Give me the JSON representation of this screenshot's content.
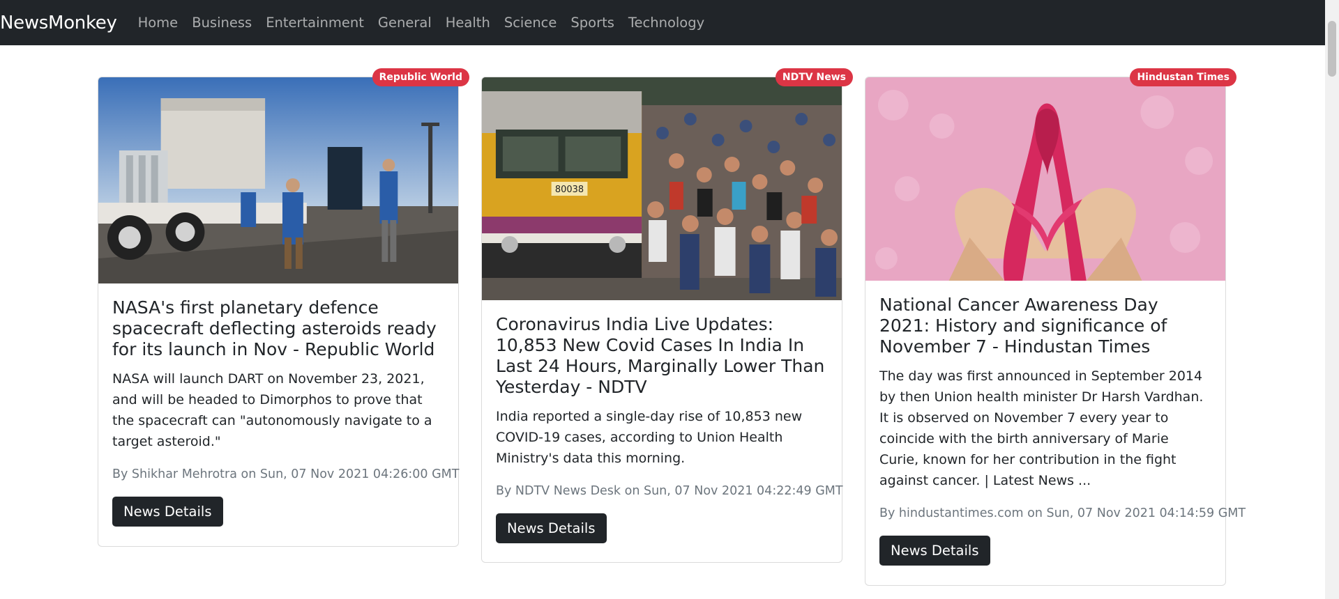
{
  "app": {
    "brand": "NewsMonkey"
  },
  "nav": {
    "items": [
      {
        "label": "Home"
      },
      {
        "label": "Business"
      },
      {
        "label": "Entertainment"
      },
      {
        "label": "General"
      },
      {
        "label": "Health"
      },
      {
        "label": "Science"
      },
      {
        "label": "Sports"
      },
      {
        "label": "Technology"
      }
    ]
  },
  "articles": [
    {
      "source": "Republic World",
      "title": "NASA's first planetary defence spacecraft deflecting asteroids ready for its launch in Nov - Republic World",
      "description": "NASA will launch DART on November 23, 2021, and will be headed to Dimorphos to prove that the spacecraft can \"autonomously navigate to a target asteroid.\"",
      "meta": "By Shikhar Mehrotra on Sun, 07 Nov 2021 04:26:00 GMT",
      "button": "News Details",
      "image_icon": "spacecraft-transport-photo"
    },
    {
      "source": "NDTV News",
      "title": "Coronavirus India Live Updates: 10,853 New Covid Cases In India In Last 24 Hours, Marginally Lower Than Yesterday - NDTV",
      "description": "India reported a single-day rise of 10,853 new COVID-19 cases, according to Union Health Ministry's data this morning.",
      "meta": "By NDTV News Desk on Sun, 07 Nov 2021 04:22:49 GMT",
      "button": "News Details",
      "image_icon": "crowded-train-photo",
      "image_text": "80038"
    },
    {
      "source": "Hindustan Times",
      "title": "National Cancer Awareness Day 2021: History and significance of November 7 - Hindustan Times",
      "description": "The day was first announced in September 2014 by then Union health minister Dr Harsh Vardhan. It is observed on November 7 every year to coincide with the birth anniversary of Marie Curie, known for her contribution in the fight against cancer. | Latest News ...",
      "meta": "By hindustantimes.com on Sun, 07 Nov 2021 04:14:59 GMT",
      "button": "News Details",
      "image_icon": "awareness-ribbon-photo"
    }
  ],
  "colors": {
    "navbar": "#212529",
    "badge": "#dc3545",
    "button": "#212529",
    "meta_text": "#6c757d"
  }
}
